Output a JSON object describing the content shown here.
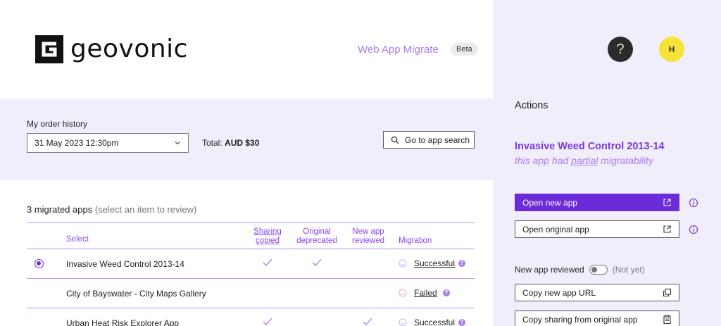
{
  "header": {
    "brand": "geovonic",
    "app_title": "Web App Migrate",
    "beta_label": "Beta"
  },
  "order": {
    "label": "My order history",
    "selected": "31 May 2023 12:30pm",
    "total_label": "Total:",
    "total_value": "AUD $30",
    "search_button": "Go to app search"
  },
  "migrated": {
    "title": "3 migrated apps",
    "hint": "(select an item to review)",
    "columns": {
      "select": "Select",
      "sharing": [
        "Sharing",
        "copied"
      ],
      "deprecated": [
        "Original",
        "deprecated"
      ],
      "reviewed": [
        "New app",
        "reviewed"
      ],
      "migration": "Migration"
    },
    "rows": [
      {
        "name": "Invasive Weed Control 2013-14",
        "selected": true,
        "sharing": true,
        "deprecated": true,
        "reviewed": false,
        "status": "Successful"
      },
      {
        "name": "City of Bayswater - City Maps Gallery",
        "selected": false,
        "sharing": false,
        "deprecated": false,
        "reviewed": false,
        "status": "Failed"
      },
      {
        "name": "Urban Heat Risk Explorer App",
        "selected": false,
        "sharing": true,
        "deprecated": false,
        "reviewed": true,
        "status": "Successful"
      }
    ]
  },
  "panel": {
    "help_label": "?",
    "avatar_initial": "H",
    "actions_title": "Actions",
    "app_name": "Invasive Weed Control 2013-14",
    "app_sub_prefix": "this app had ",
    "app_sub_emph": "partial",
    "app_sub_suffix": " migratability",
    "open_new": "Open new app",
    "open_original": "Open original app",
    "reviewed_label": "New app reviewed",
    "reviewed_state": "(Not yet)",
    "copy_url": "Copy new app URL",
    "copy_sharing": "Copy sharing from original app"
  },
  "colors": {
    "accent": "#6b2bd9",
    "accent_light": "#a97cf0",
    "panel_bg": "#f1eefc"
  }
}
